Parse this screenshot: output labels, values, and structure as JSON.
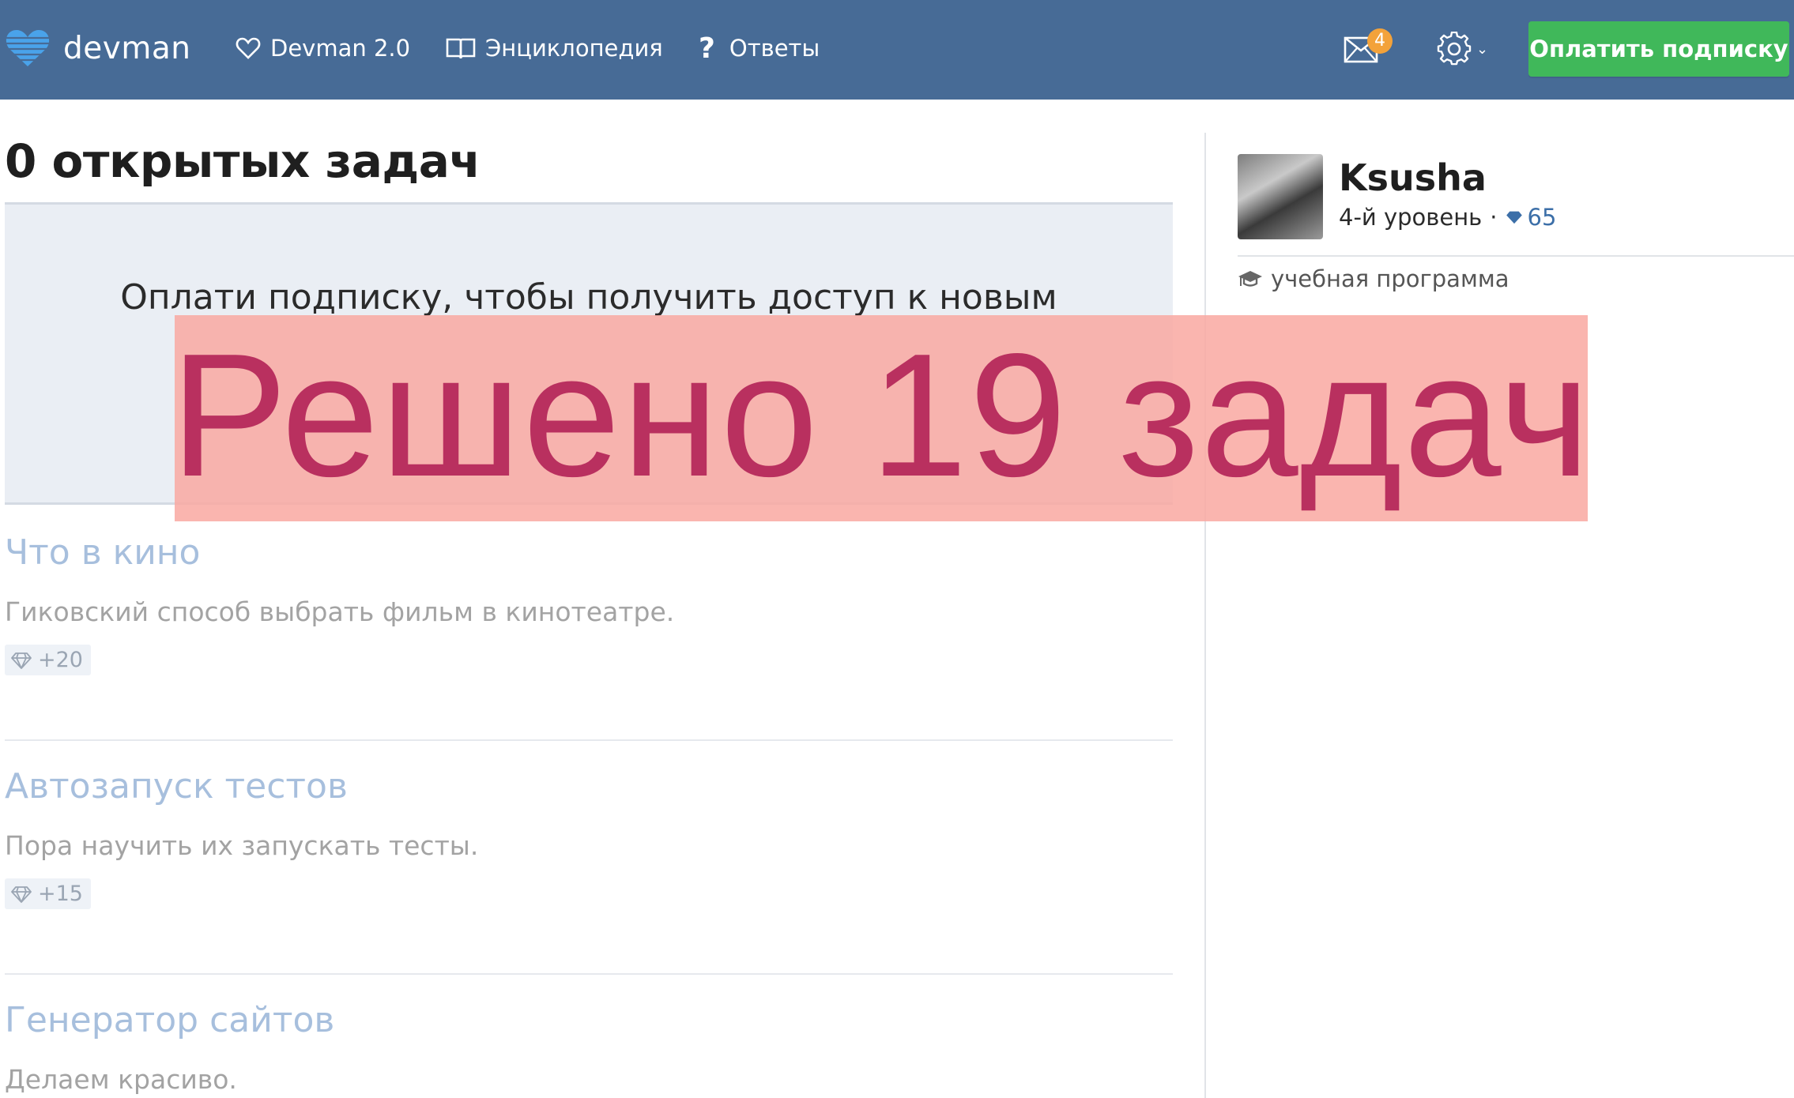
{
  "navbar": {
    "logo_text": "devman",
    "links": [
      {
        "label": "Devman 2.0",
        "icon": "heart-icon"
      },
      {
        "label": "Энциклопедия",
        "icon": "book-icon"
      },
      {
        "label": "Ответы",
        "icon": "question-icon",
        "glyph": "?"
      }
    ],
    "mail_badge": "4",
    "pay_button": "Оплатить подписку"
  },
  "main": {
    "title": "0 открытых задач",
    "promo_text": "Оплати подписку, чтобы получить доступ к новым",
    "tasks": [
      {
        "title": "Что в кино",
        "description": "Гиковский способ выбрать фильм в кинотеатре.",
        "reward": "+20"
      },
      {
        "title": "Автозапуск тестов",
        "description": "Пора научить их запускать тесты.",
        "reward": "+15"
      },
      {
        "title": "Генератор сайтов",
        "description": "Делаем красиво."
      }
    ]
  },
  "sidebar": {
    "user_name": "Ksusha",
    "level": "4-й уровень",
    "separator": "·",
    "points": "65",
    "program_link": "учебная программа"
  },
  "overlay": {
    "text": "Решено 19 задач"
  },
  "colors": {
    "navbar": "#476b96",
    "pay_button": "#40b85a",
    "badge": "#f3a23a",
    "task_title": "#a7bfdd",
    "overlay_bg": "#f9a9a2",
    "overlay_text": "#b9305f"
  }
}
